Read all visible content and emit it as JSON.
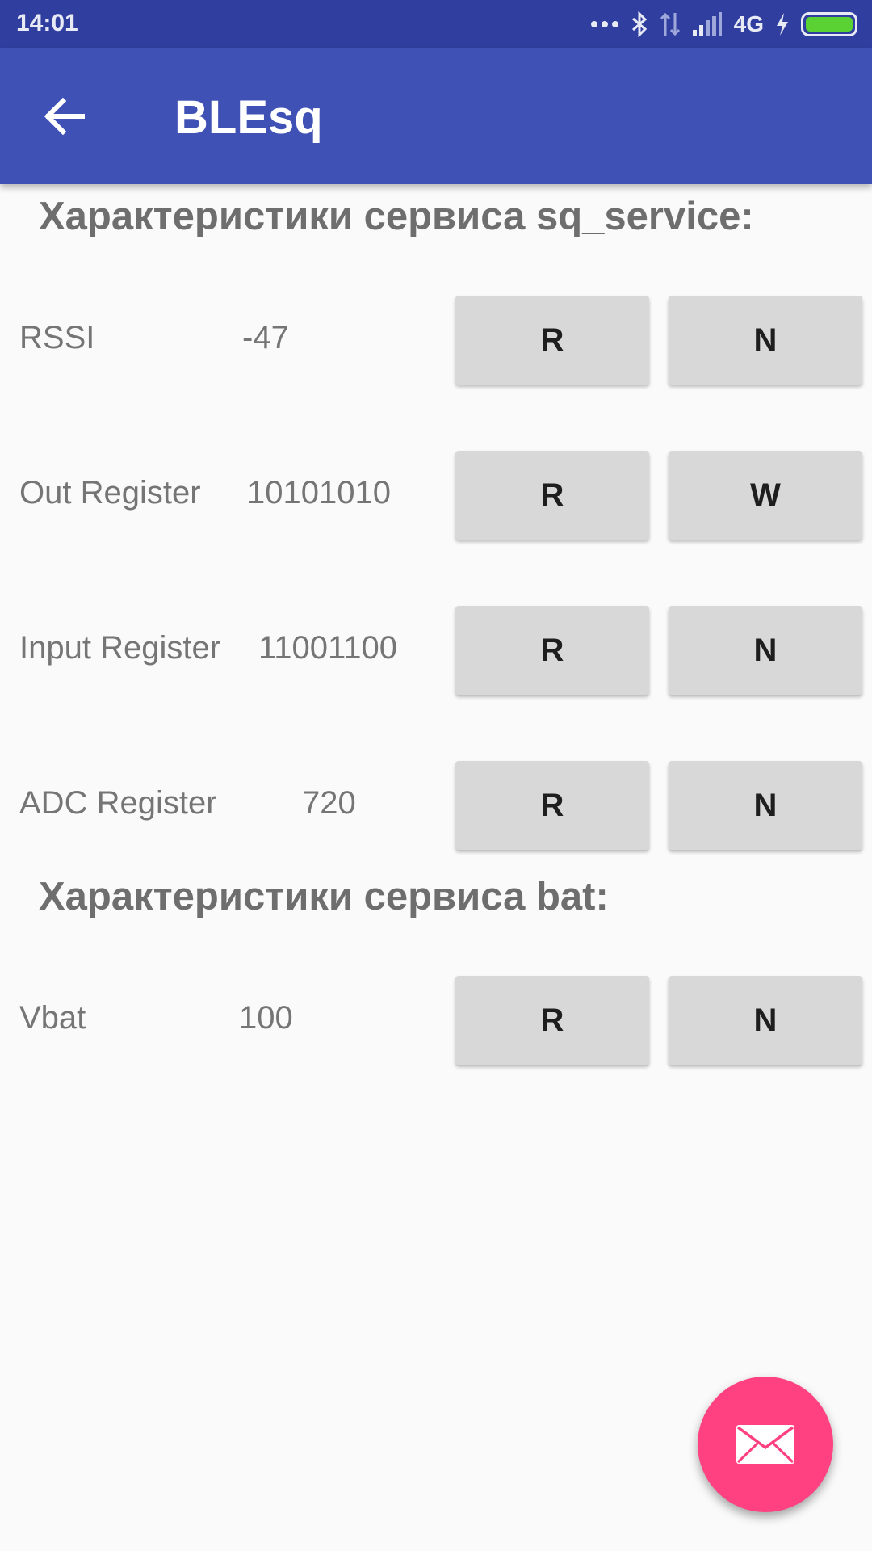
{
  "status_bar": {
    "time": "14:01",
    "signal_label": "4G",
    "icons": [
      "more-icon",
      "bluetooth-icon",
      "data-transfer-icon",
      "signal-icon",
      "charging-icon",
      "battery-icon"
    ],
    "battery_color": "#5ad234"
  },
  "app_bar": {
    "title": "BLEsq",
    "back_icon": "arrow-back-icon",
    "color": "#3f51b5"
  },
  "sections": [
    {
      "title": "Характеристики сервиса sq_service:",
      "rows": [
        {
          "label": "RSSI",
          "value": "-47",
          "btn1": "R",
          "btn2": "N"
        },
        {
          "label": "Out Register",
          "value": "10101010",
          "btn1": "R",
          "btn2": "W"
        },
        {
          "label": "Input Register",
          "value": "11001100",
          "btn1": "R",
          "btn2": "N"
        },
        {
          "label": "ADC Register",
          "value": "720",
          "btn1": "R",
          "btn2": "N"
        }
      ]
    },
    {
      "title": "Характеристики сервиса bat:",
      "rows": [
        {
          "label": "Vbat",
          "value": "100",
          "btn1": "R",
          "btn2": "N"
        }
      ]
    }
  ],
  "fab": {
    "icon": "mail-icon",
    "color": "#ff4081"
  }
}
